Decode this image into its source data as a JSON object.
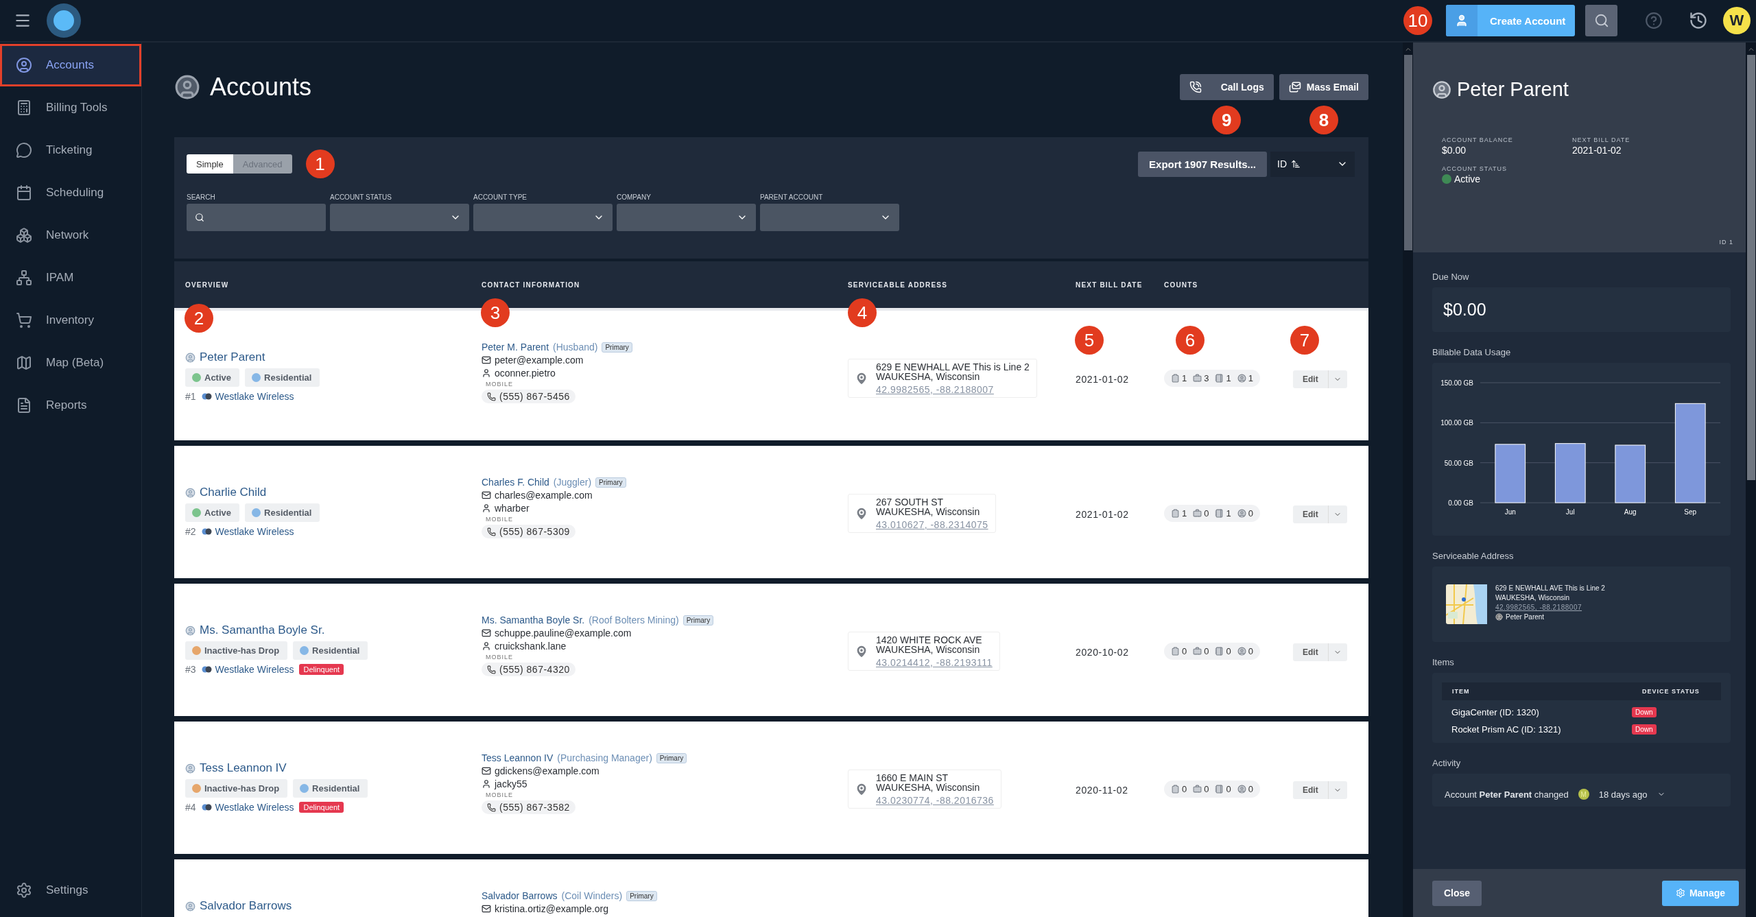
{
  "topbar": {
    "callout": "10",
    "create_button": "Create Account",
    "avatar": "W"
  },
  "sidebar": {
    "items": [
      {
        "label": "Accounts",
        "selected": true
      },
      {
        "label": "Billing Tools",
        "selected": false
      },
      {
        "label": "Ticketing",
        "selected": false
      },
      {
        "label": "Scheduling",
        "selected": false
      },
      {
        "label": "Network",
        "selected": false
      },
      {
        "label": "IPAM",
        "selected": false
      },
      {
        "label": "Inventory",
        "selected": false
      },
      {
        "label": "Map (Beta)",
        "selected": false
      },
      {
        "label": "Reports",
        "selected": false
      }
    ],
    "settings": "Settings"
  },
  "page": {
    "title": "Accounts",
    "actions": [
      {
        "label": "Call Logs",
        "kind": "calls",
        "callout": "9"
      },
      {
        "label": "Mass Email",
        "kind": "email",
        "callout": "8"
      }
    ]
  },
  "filters": {
    "modes": [
      {
        "label": "Simple",
        "selected": true
      },
      {
        "label": "Advanced",
        "selected": false
      }
    ],
    "callout": "1",
    "export_button": "Export 1907 Results...",
    "sort": "ID",
    "fields": [
      {
        "label": "SEARCH",
        "kind": "search"
      },
      {
        "label": "ACCOUNT STATUS",
        "kind": "select"
      },
      {
        "label": "ACCOUNT TYPE",
        "kind": "select"
      },
      {
        "label": "COMPANY",
        "kind": "select"
      },
      {
        "label": "PARENT ACCOUNT",
        "kind": "select"
      }
    ]
  },
  "table": {
    "columns": [
      "OVERVIEW",
      "CONTACT INFORMATION",
      "SERVICEABLE ADDRESS",
      "NEXT BILL DATE",
      "COUNTS"
    ],
    "callouts": [
      "2",
      "3",
      "4",
      "5",
      "6",
      "7"
    ],
    "rows": [
      {
        "name": "Peter Parent",
        "status": {
          "label": "Active",
          "color": "#7cc48d"
        },
        "type": {
          "label": "Residential",
          "color": "#86b7e6"
        },
        "number": "#1",
        "company": "Westlake Wireless",
        "contact": {
          "name": "Peter M. Parent",
          "role": "(Husband)",
          "badge": "Primary",
          "email": "peter@example.com",
          "username": "oconner.pietro",
          "phone_label": "MOBILE",
          "phone": "(555) 867-5456"
        },
        "address": {
          "line1": "629 E NEWHALL AVE This is Line 2",
          "line2": "WAUKESHA, Wisconsin",
          "coords": "42.9982565, -88.2188007"
        },
        "next_bill_date": "2021-01-02",
        "counts": [
          "1",
          "3",
          "1",
          "1"
        ],
        "edit": "Edit"
      },
      {
        "name": "Charlie Child",
        "status": {
          "label": "Active",
          "color": "#7cc48d"
        },
        "type": {
          "label": "Residential",
          "color": "#86b7e6"
        },
        "number": "#2",
        "company": "Westlake Wireless",
        "contact": {
          "name": "Charles F. Child",
          "role": "(Juggler)",
          "badge": "Primary",
          "email": "charles@example.com",
          "username": "wharber",
          "phone_label": "MOBILE",
          "phone": "(555) 867-5309"
        },
        "address": {
          "line1": "267 SOUTH ST",
          "line2": "WAUKESHA, Wisconsin",
          "coords": "43.010627, -88.2314075"
        },
        "next_bill_date": "2021-01-02",
        "counts": [
          "1",
          "0",
          "1",
          "0"
        ],
        "edit": "Edit"
      },
      {
        "name": "Ms. Samantha Boyle Sr.",
        "status": {
          "label": "Inactive-has Drop",
          "color": "#e6a66b"
        },
        "type": {
          "label": "Residential",
          "color": "#86b7e6"
        },
        "number": "#3",
        "company": "Westlake Wireless",
        "flag": "Delinquent",
        "contact": {
          "name": "Ms. Samantha Boyle Sr.",
          "role": "(Roof Bolters Mining)",
          "badge": "Primary",
          "email": "schuppe.pauline@example.com",
          "username": "cruickshank.lane",
          "phone_label": "MOBILE",
          "phone": "(555) 867-4320"
        },
        "address": {
          "line1": "1420 WHITE ROCK AVE",
          "line2": "WAUKESHA, Wisconsin",
          "coords": "43.0214412, -88.2193111"
        },
        "next_bill_date": "2020-10-02",
        "counts": [
          "0",
          "0",
          "0",
          "0"
        ],
        "edit": "Edit"
      },
      {
        "name": "Tess Leannon IV",
        "status": {
          "label": "Inactive-has Drop",
          "color": "#e6a66b"
        },
        "type": {
          "label": "Residential",
          "color": "#86b7e6"
        },
        "number": "#4",
        "company": "Westlake Wireless",
        "flag": "Delinquent",
        "contact": {
          "name": "Tess Leannon IV",
          "role": "(Purchasing Manager)",
          "badge": "Primary",
          "email": "gdickens@example.com",
          "username": "jacky55",
          "phone_label": "MOBILE",
          "phone": "(555) 867-3582"
        },
        "address": {
          "line1": "1660 E MAIN ST",
          "line2": "WAUKESHA, Wisconsin",
          "coords": "43.0230774, -88.2016736"
        },
        "next_bill_date": "2020-11-02",
        "counts": [
          "0",
          "0",
          "0",
          "0"
        ],
        "edit": "Edit"
      },
      {
        "name": "Salvador Barrows",
        "contact": {
          "name": "Salvador Barrows",
          "role": "(Coil Winders)",
          "badge": "Primary",
          "email": "kristina.ortiz@example.org"
        }
      }
    ]
  },
  "panel": {
    "name": "Peter Parent",
    "stats": [
      {
        "label": "ACCOUNT BALANCE",
        "value": "$0.00"
      },
      {
        "label": "NEXT BILL DATE",
        "value": "2021-01-02"
      },
      {
        "label": "ACCOUNT STATUS",
        "value": "Active",
        "color": "#3f8a55"
      }
    ],
    "id": "ID 1",
    "due_now": {
      "label": "Due Now",
      "value": "$0.00"
    },
    "usage": {
      "title": "Billable Data Usage",
      "chart_data": {
        "type": "bar",
        "categories": [
          "Jun",
          "Jul",
          "Aug",
          "Sep"
        ],
        "values": [
          73,
          74,
          72,
          124
        ],
        "ylim": [
          0,
          150
        ],
        "yticks": [
          {
            "value": 0,
            "label": "0.00 GB"
          },
          {
            "value": 50,
            "label": "50.00 GB"
          },
          {
            "value": 100,
            "label": "100.00 GB"
          },
          {
            "value": 150,
            "label": "150.00 GB"
          }
        ]
      }
    },
    "address": {
      "title": "Serviceable Address",
      "line1": "629 E NEWHALL AVE This is Line 2",
      "line2": "WAUKESHA, Wisconsin",
      "coords": "42.9982565, -88.2188007",
      "contact": "Peter Parent"
    },
    "items": {
      "title": "Items",
      "columns": [
        "ITEM",
        "DEVICE STATUS"
      ],
      "rows": [
        {
          "name": "GigaCenter (ID: 1320)",
          "status": "Down"
        },
        {
          "name": "Rocket Prism AC (ID: 1321)",
          "status": "Down"
        }
      ]
    },
    "activity": {
      "title": "Activity",
      "entries": [
        {
          "text": "Account **Peter Parent** changed",
          "avatar": "M",
          "time": "18 days ago"
        }
      ]
    },
    "buttons": {
      "close": "Close",
      "manage": "Manage"
    }
  }
}
